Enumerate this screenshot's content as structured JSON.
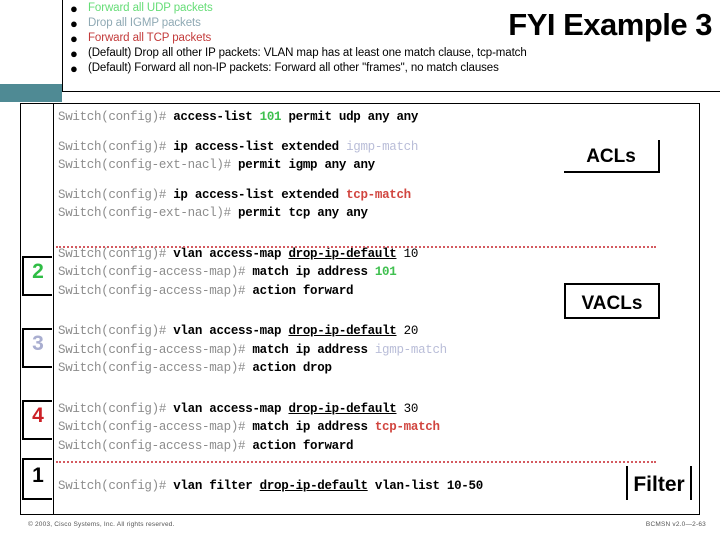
{
  "header": {
    "title": "FYI Example 3",
    "bullets": [
      {
        "text": "Forward all UDP packets",
        "color_class": "bl-green",
        "color": "#66dd77"
      },
      {
        "text": "Drop all IGMP packets",
        "color_class": "bl-blue",
        "color": "#8fa9b4"
      },
      {
        "text": "Forward all TCP packets",
        "color_class": "bl-red",
        "color": "#c33b3b"
      },
      {
        "text": "(Default) Drop all other IP packets: VLAN map has at least one match clause, tcp-match",
        "color_class": "bl-black",
        "color": "#000000"
      },
      {
        "text": "(Default) Forward all non-IP packets: Forward all other \"frames\", no match clauses",
        "color_class": "bl-black",
        "color": "#000000"
      }
    ]
  },
  "markers": {
    "two": "2",
    "three": "3",
    "four": "4",
    "one": "1"
  },
  "callouts": {
    "acls": "ACLs",
    "vacls": "VACLs",
    "filter": "Filter"
  },
  "code": {
    "acl_block": {
      "l1_prompt": "Switch(config)#",
      "l1_cmd": " access-list ",
      "l1_num": "101",
      "l1_rest": " permit udp any any",
      "l2_prompt": "Switch(config)#",
      "l2_cmd": " ip access-list extended ",
      "l2_name": "igmp-match",
      "l3_prompt": "Switch(config-ext-nacl)#",
      "l3_cmd": " permit igmp any any",
      "l4_prompt": "Switch(config)#",
      "l4_cmd": " ip access-list extended ",
      "l4_name": "tcp-match",
      "l5_prompt": "Switch(config-ext-nacl)#",
      "l5_cmd": " permit tcp any any"
    },
    "vacl_block_10": {
      "l1_prompt": "Switch(config)#",
      "l1_cmd": " vlan access-map ",
      "l1_map": "drop-ip-default",
      "l1_seq": " 10",
      "l2_prompt": "Switch(config-access-map)#",
      "l2_cmd": " match ip address ",
      "l2_acl": "101",
      "l3_prompt": "Switch(config-access-map)#",
      "l3_cmd": " action forward"
    },
    "vacl_block_20": {
      "l1_prompt": "Switch(config)#",
      "l1_cmd": " vlan access-map ",
      "l1_map": "drop-ip-default",
      "l1_seq": " 20",
      "l2_prompt": "Switch(config-access-map)#",
      "l2_cmd": " match ip address ",
      "l2_acl": "igmp-match",
      "l3_prompt": "Switch(config-access-map)#",
      "l3_cmd": " action drop"
    },
    "vacl_block_30": {
      "l1_prompt": "Switch(config)#",
      "l1_cmd": " vlan access-map ",
      "l1_map": "drop-ip-default",
      "l1_seq": " 30",
      "l2_prompt": "Switch(config-access-map)#",
      "l2_cmd": " match ip address ",
      "l2_acl": "tcp-match",
      "l3_prompt": "Switch(config-access-map)#",
      "l3_cmd": " action forward"
    },
    "filter_block": {
      "l1_prompt": "Switch(config)#",
      "l1_cmd": " vlan filter ",
      "l1_map": "drop-ip-default",
      "l1_rest": " vlan-list 10-50"
    }
  },
  "footer": {
    "copyright": "© 2003, Cisco Systems, Inc. All rights reserved.",
    "course_code": "BCMSN v2.0—2-63"
  }
}
